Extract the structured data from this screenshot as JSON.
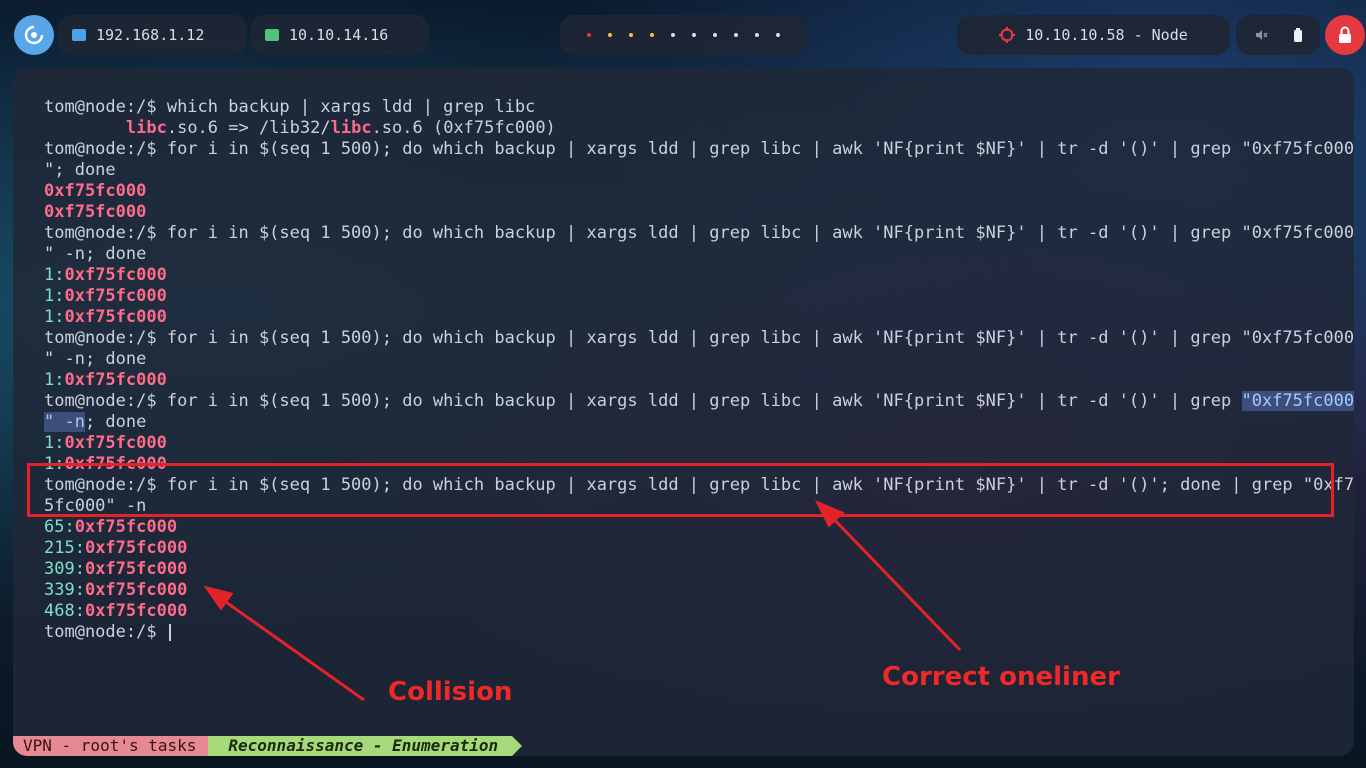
{
  "topbar": {
    "ip_local": "192.168.1.12",
    "ip_vpn": "10.10.14.16",
    "target": "10.10.10.58 - Node",
    "workspace_dots": [
      "#e5393f",
      "#f0c040",
      "#f0c040",
      "#f0c040",
      "#d8dde6",
      "#d8dde6",
      "#d8dde6",
      "#d8dde6",
      "#d8dde6",
      "#d8dde6"
    ]
  },
  "terminal": {
    "prompt": "tom@node:/$",
    "lines": {
      "l1_cmd": " which backup | xargs ldd | grep libc",
      "l2_pre": "        ",
      "l2_libc": "libc",
      "l2_mid": ".so.6 => /lib32/",
      "l2_libc2": "libc",
      "l2_post": ".so.6 (0xf75fc000)",
      "cmd_a_1": " for i in $(seq 1 500); do which backup | xargs ldd | grep libc | awk 'NF{print $NF}' | tr -d '()' | grep \"0xf75fc000",
      "cmd_a_2": "\"; done",
      "out_hex": "0xf75fc000",
      "cmd_b_2": "\" -n; done",
      "out_one": "1:",
      "cmd_c_pre": " for i in $(seq 1 500); do which backup | xargs ldd | grep libc | awk 'NF{print $NF}' | tr -d '()' | grep ",
      "cmd_c_sel": "\"0xf75fc000",
      "cmd_c_2_sel": "\" -n",
      "cmd_c_2_post": "; done",
      "cmd_d_1": " for i in $(seq 1 500); do which backup | xargs ldd | grep libc | awk 'NF{print $NF}' | tr -d '()'; done | grep \"0xf7",
      "cmd_d_2": "5fc000\" -n",
      "results": [
        {
          "n": "65:",
          "hex": "0xf75fc000"
        },
        {
          "n": "215:",
          "hex": "0xf75fc000"
        },
        {
          "n": "309:",
          "hex": "0xf75fc000"
        },
        {
          "n": "339:",
          "hex": "0xf75fc000"
        },
        {
          "n": "468:",
          "hex": "0xf75fc000"
        }
      ]
    }
  },
  "annotations": {
    "collision": "Collision",
    "correct": "Correct oneliner"
  },
  "statusbar": {
    "session": "VPN - root's tasks",
    "window": "Reconnaissance - Enumeration"
  }
}
